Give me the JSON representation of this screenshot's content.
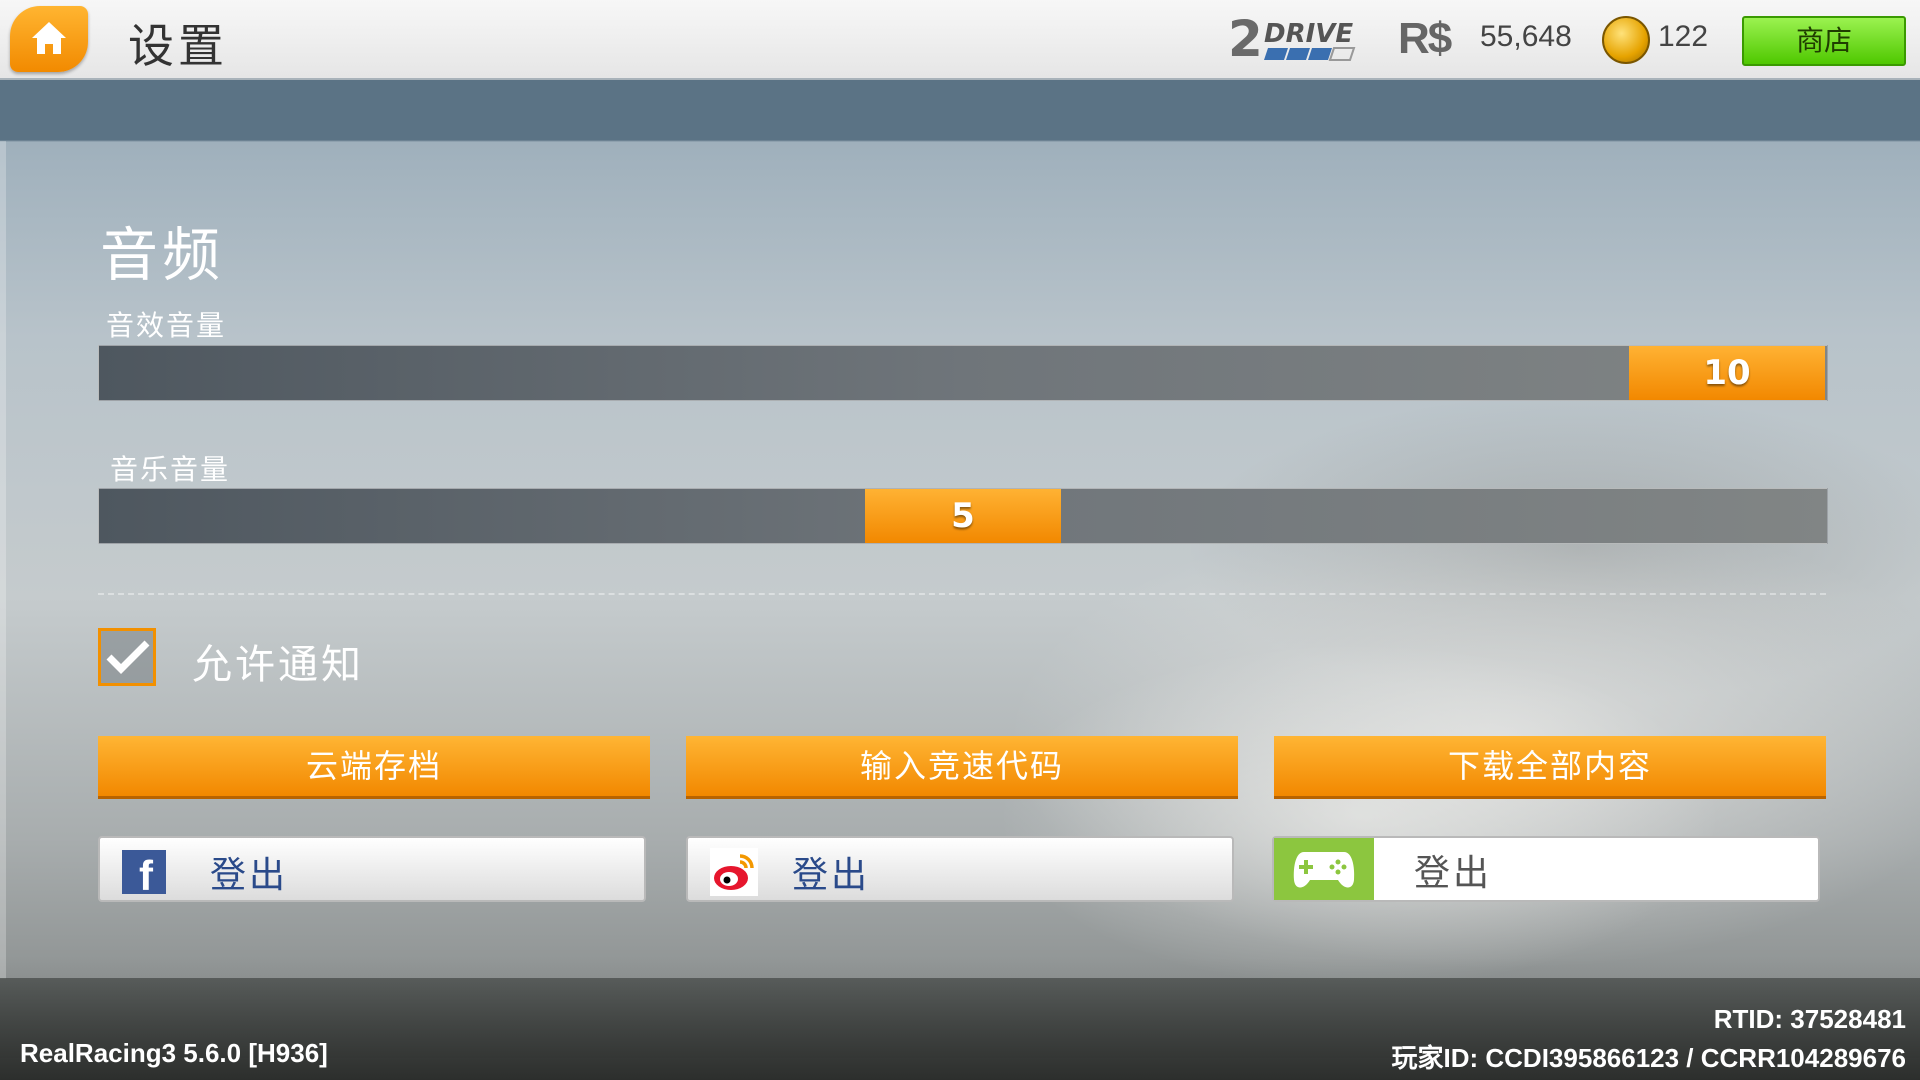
{
  "header": {
    "title": "设置",
    "logo_text": "2DRIVE",
    "cash_symbol": "R$",
    "cash_value": "55,648",
    "gold_value": "122",
    "shop_label": "商店"
  },
  "audio": {
    "section_title": "音频",
    "sfx": {
      "label": "音效音量",
      "value": "10",
      "level": 10,
      "max": 10
    },
    "music": {
      "label": "音乐音量",
      "value": "5",
      "level": 5,
      "max": 10
    }
  },
  "notifications": {
    "label": "允许通知",
    "checked": true
  },
  "actions": [
    {
      "label": "云端存档"
    },
    {
      "label": "输入竞速代码"
    },
    {
      "label": "下载全部内容"
    }
  ],
  "social": [
    {
      "service": "facebook",
      "icon": "facebook-icon",
      "label": "登出"
    },
    {
      "service": "weibo",
      "icon": "weibo-icon",
      "label": "登出"
    },
    {
      "service": "game-center",
      "icon": "gamepad-icon",
      "label": "登出"
    }
  ],
  "footer": {
    "version": "RealRacing3 5.6.0 [H936]",
    "rtid": "RTID:  37528481",
    "player_id": "玩家ID:  CCDI395866123 / CCRR104289676"
  },
  "colors": {
    "accent": "#f28800",
    "shop_green": "#4fc800",
    "facebook": "#3b5998",
    "gamepad": "#8cc63f"
  }
}
